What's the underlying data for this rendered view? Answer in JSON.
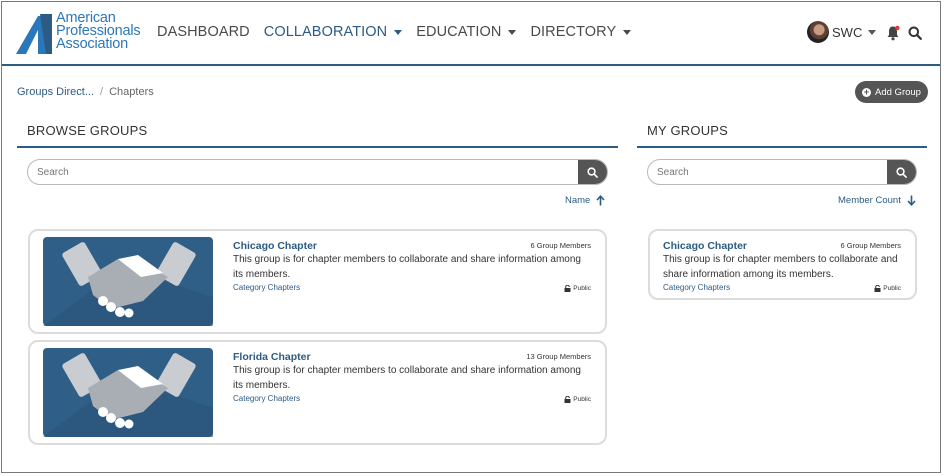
{
  "logo": {
    "line1": "American",
    "line2": "Professionals",
    "line3": "Association"
  },
  "nav": [
    {
      "label": "DASHBOARD"
    },
    {
      "label": "COLLABORATION"
    },
    {
      "label": "EDUCATION"
    },
    {
      "label": "DIRECTORY"
    }
  ],
  "user": {
    "label": "SWC"
  },
  "icons": {
    "bell": "bell-icon",
    "search": "search-icon",
    "add": "plus-circle-icon",
    "lock": "lock-icon",
    "sort_up": "arrow-up-icon",
    "sort_down": "arrow-down-icon",
    "handshake": "handshake-image"
  },
  "colors": {
    "brand": "#2c5b84",
    "logo": "#2a77b9",
    "dark_button": "#555555",
    "notification": "#e23b3b"
  },
  "breadcrumb": {
    "parent": "Groups Direct...",
    "separator": "/",
    "current": "Chapters"
  },
  "add_group_label": "Add Group",
  "browse": {
    "title": "BROWSE GROUPS",
    "search_placeholder": "Search",
    "sort_label": "Name",
    "groups": [
      {
        "name": "Chicago Chapter",
        "members": "6 Group Members",
        "description": "This group is for chapter members to collaborate and share information among its members.",
        "category": "Category Chapters",
        "privacy": "Public"
      },
      {
        "name": "Florida Chapter",
        "members": "13 Group Members",
        "description": "This group is for chapter members to collaborate and share information among its members.",
        "category": "Category Chapters",
        "privacy": "Public"
      }
    ]
  },
  "my_groups": {
    "title": "MY GROUPS",
    "search_placeholder": "Search",
    "sort_label": "Member Count",
    "groups": [
      {
        "name": "Chicago Chapter",
        "members": "6 Group Members",
        "description": "This group is for chapter members to collaborate and share information among its members.",
        "category": "Category Chapters",
        "privacy": "Public"
      }
    ]
  }
}
